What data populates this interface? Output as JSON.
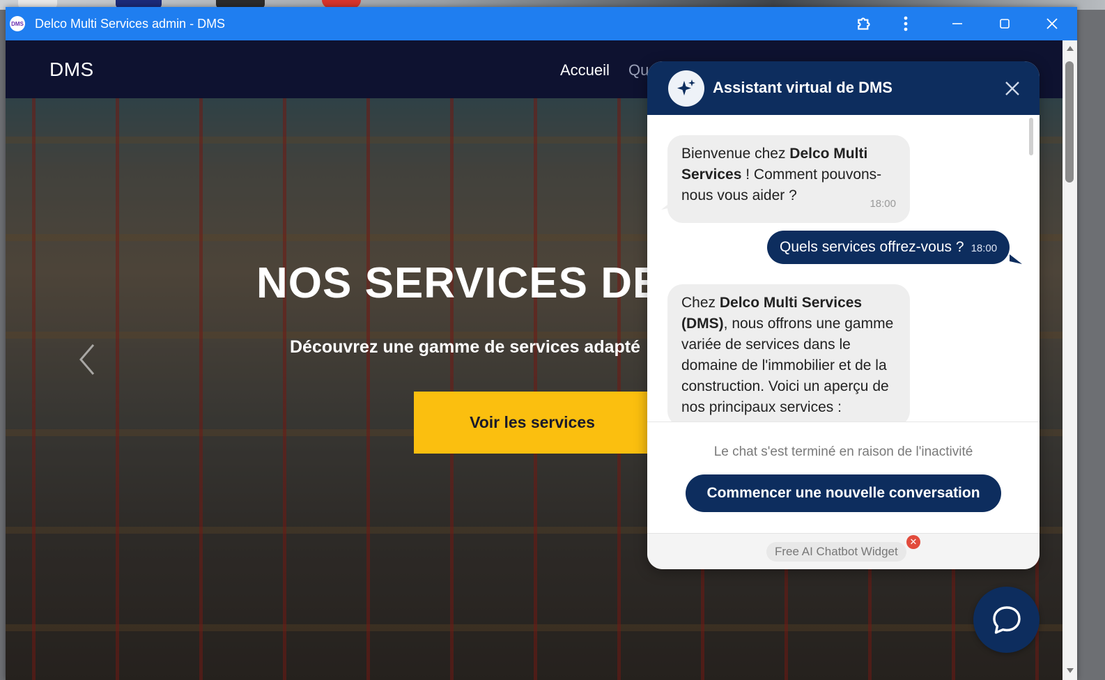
{
  "window": {
    "title": "Delco Multi Services admin - DMS",
    "app_icon_text": "DMS"
  },
  "navbar": {
    "brand": "DMS",
    "links": [
      "Accueil",
      "Qu"
    ]
  },
  "hero": {
    "title": "NOS SERVICES DE C",
    "subtitle": "Découvrez une gamme de services adapté",
    "button": "Voir les services"
  },
  "chat": {
    "title": "Assistant virtual de DMS",
    "messages": [
      {
        "from": "bot",
        "parts": [
          {
            "text": "Bienvenue chez ",
            "bold": false
          },
          {
            "text": "Delco Multi Services",
            "bold": true
          },
          {
            "text": " ! Comment pouvons-nous vous aider ?",
            "bold": false
          }
        ],
        "time": "18:00"
      },
      {
        "from": "user",
        "text": "Quels services offrez-vous ?",
        "time": "18:00"
      },
      {
        "from": "bot",
        "parts": [
          {
            "text": "Chez ",
            "bold": false
          },
          {
            "text": "Delco Multi Services (DMS)",
            "bold": true
          },
          {
            "text": ", nous offrons une gamme variée de services dans le domaine de l'immobilier et de la construction. Voici un aperçu de nos principaux services :",
            "bold": false
          }
        ]
      }
    ],
    "ended_text": "Le chat s'est terminé en raison de l'inactivité",
    "new_conversation": "Commencer une nouvelle conversation",
    "branding": "Free AI Chatbot Widget"
  },
  "colors": {
    "titlebar": "#1f7ef0",
    "navbar": "#0e1230",
    "chat_primary": "#0d2d5e",
    "cta_yellow": "#fbbf0f"
  },
  "icons": [
    "extensions-icon",
    "more-vert-icon",
    "minimize-icon",
    "maximize-icon",
    "close-icon",
    "sparkles-icon",
    "chat-bubble-icon",
    "chevron-left-icon"
  ]
}
